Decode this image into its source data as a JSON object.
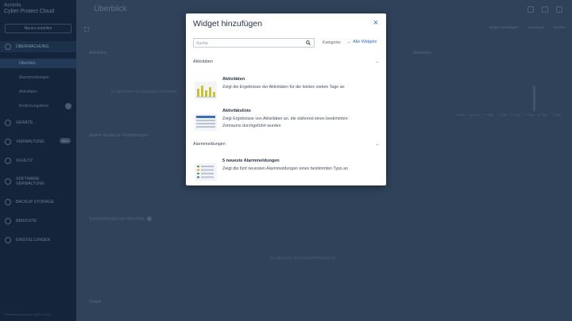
{
  "sidebar": {
    "brand": "Acronis",
    "brand_sub": "Cyber Protect Cloud",
    "new_button": "Neues erstellen",
    "items": [
      {
        "label": "ÜBERWACHUNG"
      },
      {
        "label": "GERÄTE"
      },
      {
        "label": "VERWALTUNG",
        "badge": "NEU"
      },
      {
        "label": "SCHUTZ"
      },
      {
        "label": "SOFTWARE-VERWALTUNG"
      },
      {
        "label": "BACKUP STORAGE"
      },
      {
        "label": "BERICHTE"
      },
      {
        "label": "EINSTELLUNGEN"
      }
    ],
    "subitems": [
      {
        "label": "Überblick"
      },
      {
        "label": "Alarmmeldungen"
      },
      {
        "label": "Aktivitäten"
      },
      {
        "label": "Bedrohungsfeed"
      }
    ],
    "footer": "Powered by Acronis Cyber Cloud"
  },
  "main": {
    "title": "Überblick",
    "toolbar": [
      "Widget hinzufügen",
      "Download",
      "Senden"
    ],
    "panels": [
      "Aktivitäten",
      "Aktivitäten",
      "Andere Geräte als Vermeldungen",
      "Sicherheitsstatus der Maschine",
      "Details"
    ],
    "empty_texts": [
      "Es gibt keine zu zeigenden Elemente",
      "Es gibt keine zu zeigenden Elemente"
    ],
    "chart_ticks": [
      "Heute",
      "Gestern",
      "2 Tage",
      "3 Tage",
      "4 Tage",
      "5 Tage",
      "6 Tage",
      "7 Tage"
    ]
  },
  "modal": {
    "title": "Widget hinzufügen",
    "close_label": "×",
    "search": {
      "placeholder": "Suche",
      "value": ""
    },
    "category_label": "Kategorie:",
    "category_value": "Alle Widgets",
    "sections": [
      {
        "title": "Aktivitäten",
        "widgets": [
          {
            "title": "Aktivitäten",
            "desc": "Zeigt die Ergebnisse der Aktivitäten für die letzten sieben Tage an",
            "icon": "bar-chart-icon"
          },
          {
            "title": "Aktivitätsliste",
            "desc": "Zeigt Ergebnisse von Aktivitäten an, die während eines bestimmten Zeitraums durchgeführt wurden",
            "icon": "table-icon"
          }
        ]
      },
      {
        "title": "Alarmmeldungen",
        "widgets": [
          {
            "title": "5 neueste Alarmmeldungen",
            "desc": "Zeigt die fünf neuesten Alarmmeldungen eines bestimmten Typs an",
            "icon": "list-icon"
          }
        ]
      }
    ]
  },
  "colors": {
    "accent": "#2b6dc8",
    "overlay": "#2b3e55",
    "sidebar": "#14243a"
  }
}
